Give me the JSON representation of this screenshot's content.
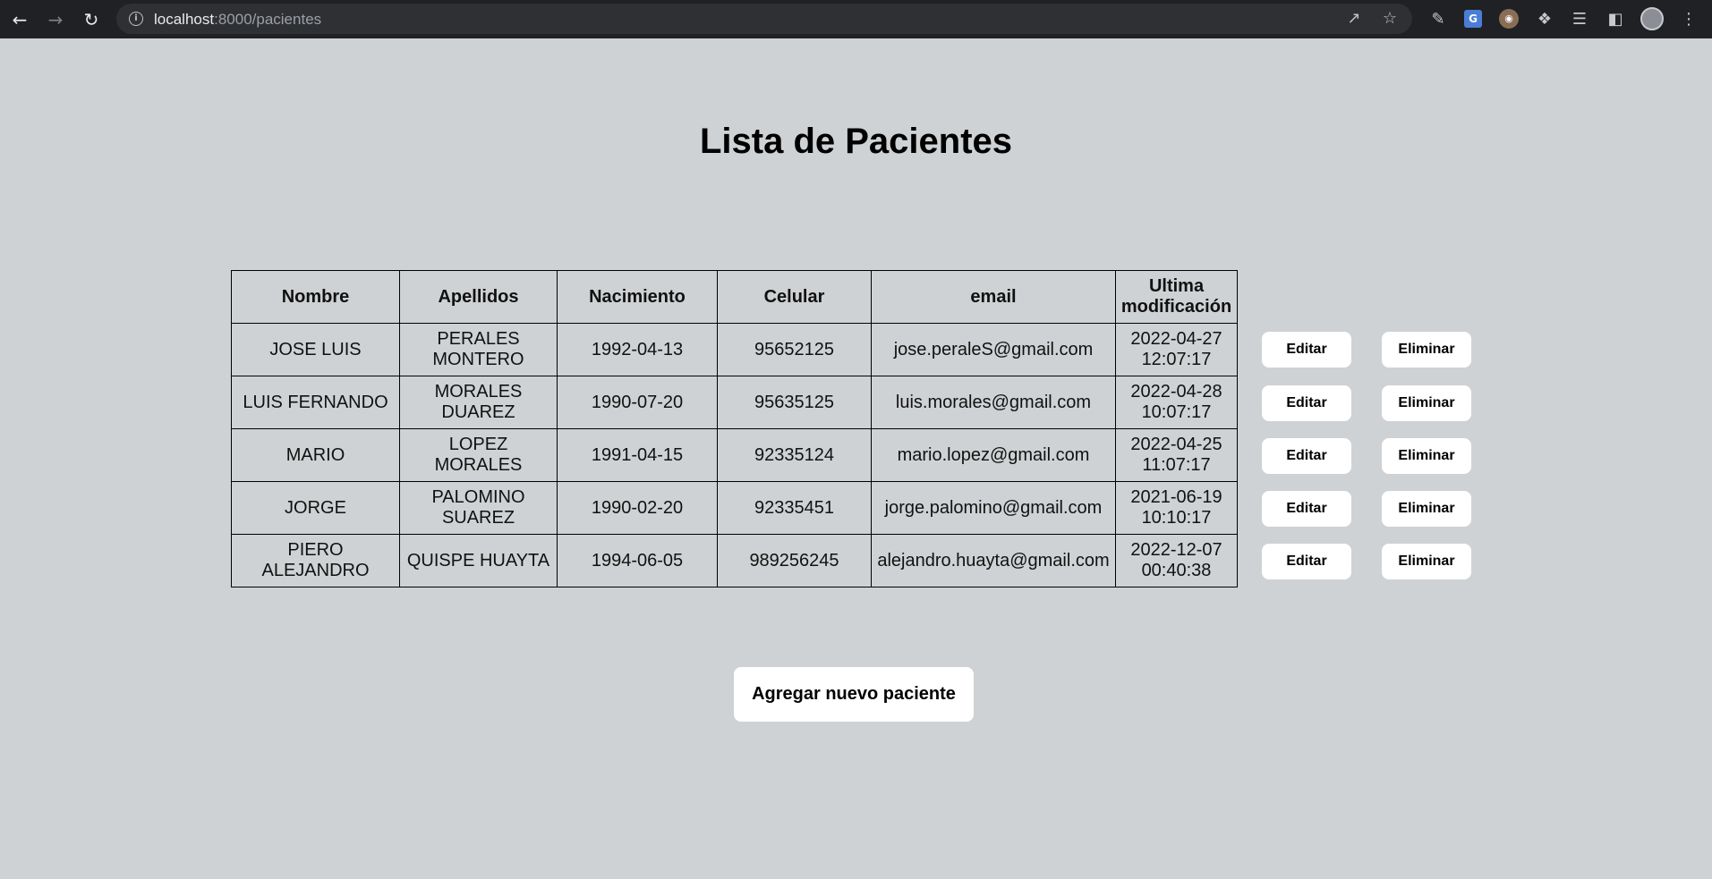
{
  "browser": {
    "url_host": "localhost",
    "url_rest": ":8000/pacientes"
  },
  "page": {
    "title": "Lista de Pacientes",
    "add_button": "Agregar nuevo paciente"
  },
  "table": {
    "headers": [
      "Nombre",
      "Apellidos",
      "Nacimiento",
      "Celular",
      "email",
      "Ultima modificación"
    ],
    "rows": [
      {
        "nombre": "JOSE LUIS",
        "apellidos": "PERALES MONTERO",
        "nacimiento": "1992-04-13",
        "celular": "95652125",
        "email": "jose.peraleS@gmail.com",
        "modificacion": "2022-04-27 12:07:17"
      },
      {
        "nombre": "LUIS FERNANDO",
        "apellidos": "MORALES DUAREZ",
        "nacimiento": "1990-07-20",
        "celular": "95635125",
        "email": "luis.morales@gmail.com",
        "modificacion": "2022-04-28 10:07:17"
      },
      {
        "nombre": "MARIO",
        "apellidos": "LOPEZ MORALES",
        "nacimiento": "1991-04-15",
        "celular": "92335124",
        "email": "mario.lopez@gmail.com",
        "modificacion": "2022-04-25 11:07:17"
      },
      {
        "nombre": "JORGE",
        "apellidos": "PALOMINO SUAREZ",
        "nacimiento": "1990-02-20",
        "celular": "92335451",
        "email": "jorge.palomino@gmail.com",
        "modificacion": "2021-06-19 10:10:17"
      },
      {
        "nombre": "PIERO ALEJANDRO",
        "apellidos": "QUISPE HUAYTA",
        "nacimiento": "1994-06-05",
        "celular": "989256245",
        "email": "alejandro.huayta@gmail.com",
        "modificacion": "2022-12-07 00:40:38"
      }
    ],
    "edit_label": "Editar",
    "delete_label": "Eliminar"
  }
}
